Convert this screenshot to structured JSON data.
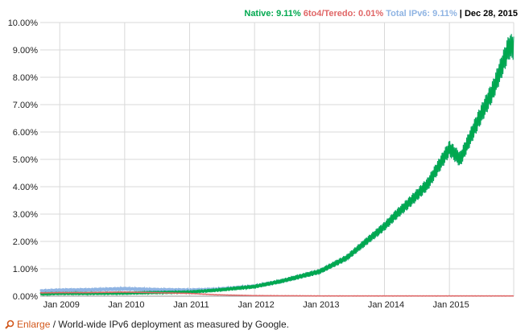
{
  "legend": {
    "native": "Native: 9.11%",
    "teredo": "6to4/Teredo: 0.01%",
    "total": "Total IPv6: 9.11%",
    "separator": " | ",
    "date": "Dec 28, 2015"
  },
  "caption": {
    "link": "Enlarge",
    "text": " / World-wide IPv6 deployment as measured by Google."
  },
  "colors": {
    "native": "#00a84f",
    "teredo": "#e06666",
    "total": "#8fb4e3",
    "date": "#000000",
    "grid": "#d9d9d9",
    "enlarge": "#d2571b"
  },
  "chart_data": {
    "type": "line",
    "xlabel": "",
    "ylabel": "",
    "ylim": [
      0,
      10
    ],
    "x_ticks": [
      "Jan 2009",
      "Jan 2010",
      "Jan 2011",
      "Jan 2012",
      "Jan 2013",
      "Jan 2014",
      "Jan 2015"
    ],
    "y_ticks": [
      "0.00%",
      "1.00%",
      "2.00%",
      "3.00%",
      "4.00%",
      "5.00%",
      "6.00%",
      "7.00%",
      "8.00%",
      "9.00%",
      "10.00%"
    ],
    "grid": true,
    "legend_position": "top-right",
    "series": [
      {
        "name": "Native",
        "x": [
          "2008-09",
          "2009-01",
          "2009-06",
          "2010-01",
          "2010-06",
          "2011-01",
          "2011-06",
          "2012-01",
          "2012-06",
          "2013-01",
          "2013-06",
          "2014-01",
          "2014-03",
          "2014-06",
          "2014-09",
          "2015-01",
          "2015-03",
          "2015-06",
          "2015-09",
          "2015-12"
        ],
        "values": [
          0.08,
          0.1,
          0.1,
          0.11,
          0.13,
          0.15,
          0.22,
          0.35,
          0.55,
          0.9,
          1.4,
          2.55,
          2.95,
          3.5,
          4.1,
          5.4,
          5.0,
          6.3,
          7.5,
          9.11
        ]
      },
      {
        "name": "6to4/Teredo",
        "x": [
          "2008-09",
          "2009-01",
          "2009-06",
          "2010-01",
          "2010-06",
          "2011-01",
          "2011-06",
          "2012-01",
          "2013-01",
          "2014-01",
          "2015-01",
          "2015-12"
        ],
        "values": [
          0.12,
          0.13,
          0.13,
          0.15,
          0.13,
          0.1,
          0.05,
          0.02,
          0.01,
          0.01,
          0.01,
          0.01
        ]
      },
      {
        "name": "Total IPv6",
        "x": [
          "2008-09",
          "2009-01",
          "2009-06",
          "2010-01",
          "2010-06",
          "2011-01",
          "2011-06",
          "2012-01",
          "2012-06",
          "2013-01",
          "2013-06",
          "2014-01",
          "2014-03",
          "2014-06",
          "2014-09",
          "2015-01",
          "2015-03",
          "2015-06",
          "2015-09",
          "2015-12"
        ],
        "values": [
          0.18,
          0.22,
          0.23,
          0.27,
          0.24,
          0.22,
          0.25,
          0.36,
          0.55,
          0.9,
          1.4,
          2.55,
          2.95,
          3.5,
          4.1,
          5.4,
          5.0,
          6.3,
          7.5,
          9.11
        ]
      }
    ]
  }
}
